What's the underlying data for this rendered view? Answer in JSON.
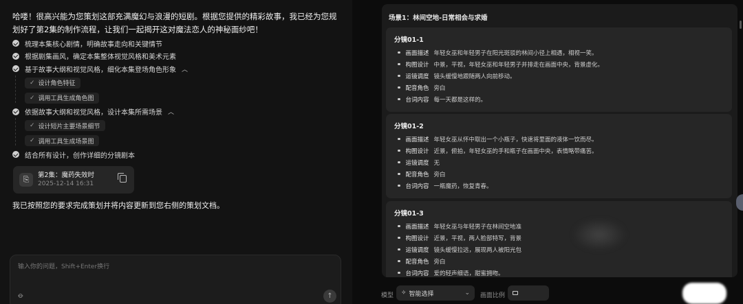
{
  "chat": {
    "intro": "哈喽！很高兴能为您策划这部充满魔幻与浪漫的短剧。根据您提供的精彩故事，我已经为您规划好了第2集的制作流程，让我们一起揭开这对魔法恋人的神秘面纱吧！",
    "steps": [
      {
        "label": "梳理本集核心剧情，明确故事走向和关键情节"
      },
      {
        "label": "根据剧集画风，确定本集整体视觉风格和美术元素"
      },
      {
        "label": "基于故事大纲和视觉风格，细化本集登场角色形象",
        "expanded": true,
        "sub": [
          "设计角色特征",
          "调用工具生成角色图"
        ]
      },
      {
        "label": "依据故事大纲和视觉风格，设计本集所需场景",
        "expanded": true,
        "sub": [
          "设计短片主要场景细节",
          "调用工具生成场景图"
        ]
      },
      {
        "label": "结合所有设计，创作详细的分镜剧本"
      }
    ],
    "file_card": {
      "title": "第2集：魔药失效时",
      "date": "2025-12-14 16:31"
    },
    "done_message": "我已按照您的要求完成策划并将内容更新到您右侧的策划文档。",
    "input": {
      "placeholder": "输入你的问题，Shift+Enter换行"
    }
  },
  "doc": {
    "scene_title": "场景1：林间空地-日常相会与求婚",
    "shots": [
      {
        "title": "分镜01-1",
        "rows": [
          {
            "label": "画面描述",
            "value": "年轻女巫和年轻男子在阳光斑驳的林间小径上相遇，相视一笑。"
          },
          {
            "label": "构图设计",
            "value": "中景，平视，年轻女巫和年轻男子并排走在画面中央，背景虚化。"
          },
          {
            "label": "运镜调度",
            "value": "镜头缓慢地跟随两人向前移动。"
          },
          {
            "label": "配音角色",
            "value": "旁白"
          },
          {
            "label": "台词内容",
            "value": "每一天都是这样的。"
          }
        ]
      },
      {
        "title": "分镜01-2",
        "rows": [
          {
            "label": "画面描述",
            "value": "年轻女巫从怀中取出一个小瓶子，快速将里面的液体一饮而尽。"
          },
          {
            "label": "构图设计",
            "value": "近景，俯拍，年轻女巫的手和瓶子在画面中央，表情略带痛苦。"
          },
          {
            "label": "运镜调度",
            "value": "无"
          },
          {
            "label": "配音角色",
            "value": "旁白"
          },
          {
            "label": "台词内容",
            "value": "一瓶魔药，恢复青春。"
          }
        ]
      },
      {
        "title": "分镜01-3",
        "rows": [
          {
            "label": "画面描述",
            "value": "年轻女巫与年轻男子在林间空地准"
          },
          {
            "label": "构图设计",
            "value": "近景，平视，两人脸部特写，背景"
          },
          {
            "label": "运镜调度",
            "value": "镜头缓慢拉远，展现两人被阳光包"
          },
          {
            "label": "配音角色",
            "value": "旁白"
          },
          {
            "label": "台词内容",
            "value": "爱的轻声细语，甜蜜拥吻。"
          }
        ]
      }
    ]
  },
  "bottom_bar": {
    "model_label": "模型",
    "model_value": "智能选择",
    "ratio_label": "画面比例"
  },
  "icons": {
    "step": "check-circle-icon",
    "file": "document-icon",
    "copy": "copy-icon",
    "attach": "paperclip-icon",
    "send": "arrow-up-icon",
    "model": "sparkle-icon",
    "ratio": "aspect-ratio-icon"
  }
}
